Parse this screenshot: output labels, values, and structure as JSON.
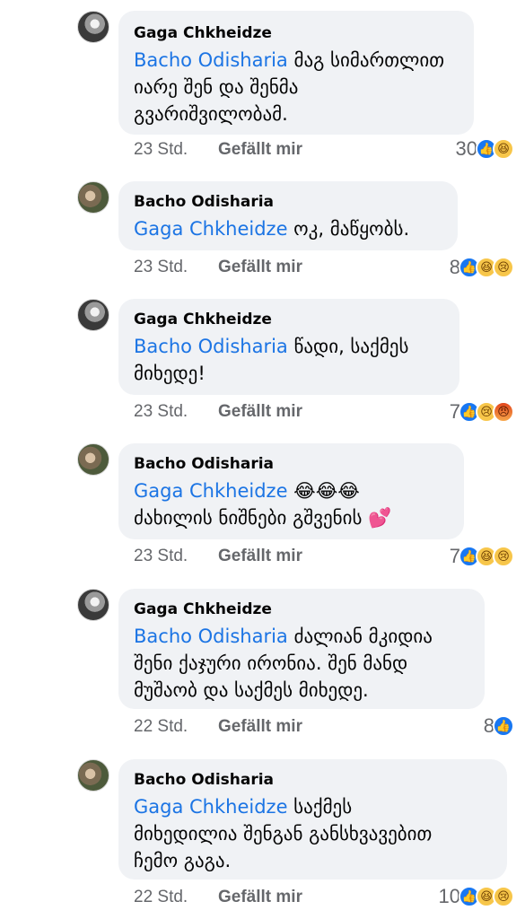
{
  "comments": [
    {
      "author": "Gaga Chkheidze",
      "mention": "Bacho Odisharia",
      "text_lines": [
        " მაგ სიმართლით",
        "იარე შენ და შენმა",
        "გვარიშვილობამ."
      ],
      "time": "23 Std.",
      "like_label": "Gefällt mir",
      "reaction_count": "30",
      "reactions": [
        "like-icon",
        "haha-icon"
      ]
    },
    {
      "author": "Bacho Odisharia",
      "mention": "Gaga Chkheidze",
      "text_lines": [
        " ოკ, მაწყობს."
      ],
      "time": "23 Std.",
      "like_label": "Gefällt mir",
      "reaction_count": "8",
      "reactions": [
        "like-icon",
        "haha-icon",
        "sad-icon"
      ]
    },
    {
      "author": "Gaga Chkheidze",
      "mention": "Bacho Odisharia",
      "text_lines": [
        " წადი, საქმეს",
        "მიხედე!"
      ],
      "time": "23 Std.",
      "like_label": "Gefällt mir",
      "reaction_count": "7",
      "reactions": [
        "like-icon",
        "sad-icon",
        "angry-icon"
      ]
    },
    {
      "author": "Bacho Odisharia",
      "mention": "Gaga Chkheidze",
      "text_lines": [
        " 😂😂😂",
        "ძახილის ნიშნები გშვენის 💕"
      ],
      "time": "23 Std.",
      "like_label": "Gefällt mir",
      "reaction_count": "7",
      "reactions": [
        "like-icon",
        "haha-icon",
        "sad-icon"
      ]
    },
    {
      "author": "Gaga Chkheidze",
      "mention": "Bacho Odisharia",
      "text_lines": [
        " ძალიან მკიდია",
        "შენი ქაჯური ირონია. შენ მანდ",
        "მუშაობ და საქმეს მიხედე."
      ],
      "time": "22 Std.",
      "like_label": "Gefällt mir",
      "reaction_count": "8",
      "reactions": [
        "like-icon"
      ]
    },
    {
      "author": "Bacho Odisharia",
      "mention": "Gaga Chkheidze",
      "text_lines": [
        " საქმეს",
        "მიხედილია შენგან განსხვავებით",
        "ჩემო გაგა."
      ],
      "time": "22 Std.",
      "like_label": "Gefällt mir",
      "reaction_count": "10",
      "reactions": [
        "like-icon",
        "haha-icon",
        "sad-icon"
      ]
    }
  ]
}
